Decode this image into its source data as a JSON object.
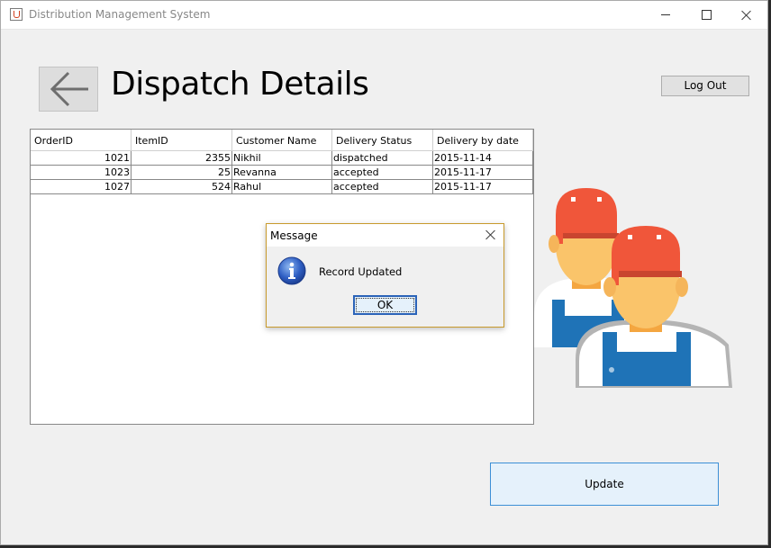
{
  "window": {
    "title": "Distribution Management System",
    "icon": "java-app-icon",
    "controls": [
      "minimize-icon",
      "maximize-icon",
      "close-icon"
    ]
  },
  "header": {
    "back_icon": "arrow-left-icon",
    "title": "Dispatch Details",
    "logout_label": "Log Out"
  },
  "table": {
    "columns": [
      "OrderID",
      "ItemID",
      "Customer Name",
      "Delivery Status",
      "Delivery by date"
    ],
    "rows": [
      [
        "1021",
        "2355",
        "Nikhil",
        "dispatched",
        "2015-11-14"
      ],
      [
        "1023",
        "25",
        "Revanna",
        "accepted",
        "2015-11-17"
      ],
      [
        "1027",
        "524",
        "Rahul",
        "accepted",
        "2015-11-17"
      ]
    ]
  },
  "dialog": {
    "title": "Message",
    "message": "Record Updated",
    "ok_label": "OK",
    "icon": "info-icon"
  },
  "illustration": {
    "name": "delivery-workers-illustration",
    "colors": {
      "cap": "#f0563a",
      "skin": "#fac46a",
      "overalls": "#1f73b7",
      "shirt": "#ffffff",
      "outline": "#b4b4b4"
    }
  },
  "actions": {
    "update_label": "Update"
  }
}
